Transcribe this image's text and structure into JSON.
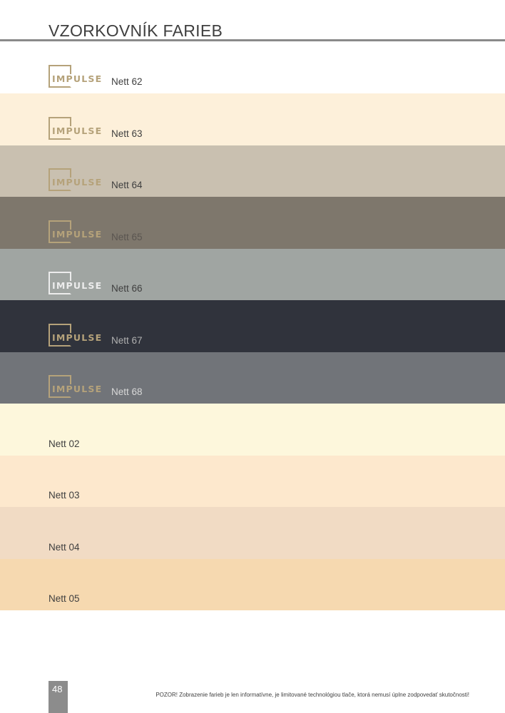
{
  "header": {
    "title": "VZORKOVNÍK FARIEB"
  },
  "swatches": [
    {
      "name": "Nett 62",
      "brand": "IMPULSE",
      "color": "#ffffff",
      "text_color": "#3f3f3f",
      "logo_color": "#b5a27a"
    },
    {
      "name": "Nett 63",
      "brand": "IMPULSE",
      "color": "#fdf0da",
      "text_color": "#3f3f3f",
      "logo_color": "#b5a27a"
    },
    {
      "name": "Nett 64",
      "brand": "IMPULSE",
      "color": "#c9c0b0",
      "text_color": "#3f3f3f",
      "logo_color": "#b5a27a"
    },
    {
      "name": "Nett 65",
      "brand": "IMPULSE",
      "color": "#7e776c",
      "text_color": "#5a5550",
      "logo_color": "#b5a27a"
    },
    {
      "name": "Nett 66",
      "brand": "IMPULSE",
      "color": "#a0a5a2",
      "text_color": "#3f3f3f",
      "logo_color": "#ececec"
    },
    {
      "name": "Nett 67",
      "brand": "IMPULSE",
      "color": "#30333c",
      "text_color": "#b0b0b0",
      "logo_color": "#b5a27a"
    },
    {
      "name": "Nett 68",
      "brand": "IMPULSE",
      "color": "#717479",
      "text_color": "#d8d8d8",
      "logo_color": "#b5a27a"
    },
    {
      "name": "Nett 02",
      "brand": "",
      "color": "#fdf7dc",
      "text_color": "#3f3f3f",
      "logo_color": ""
    },
    {
      "name": "Nett 03",
      "brand": "",
      "color": "#fde8cd",
      "text_color": "#3f3f3f",
      "logo_color": ""
    },
    {
      "name": "Nett 04",
      "brand": "",
      "color": "#f1dbc4",
      "text_color": "#3f3f3f",
      "logo_color": ""
    },
    {
      "name": "Nett 05",
      "brand": "",
      "color": "#f6d9b0",
      "text_color": "#3f3f3f",
      "logo_color": ""
    }
  ],
  "footer": {
    "page_number": "48",
    "disclaimer": "POZOR! Zobrazenie farieb je len informatívne, je limitované technológiou tlače, ktorá nemusí úplne zodpovedať skutočnosti!"
  }
}
